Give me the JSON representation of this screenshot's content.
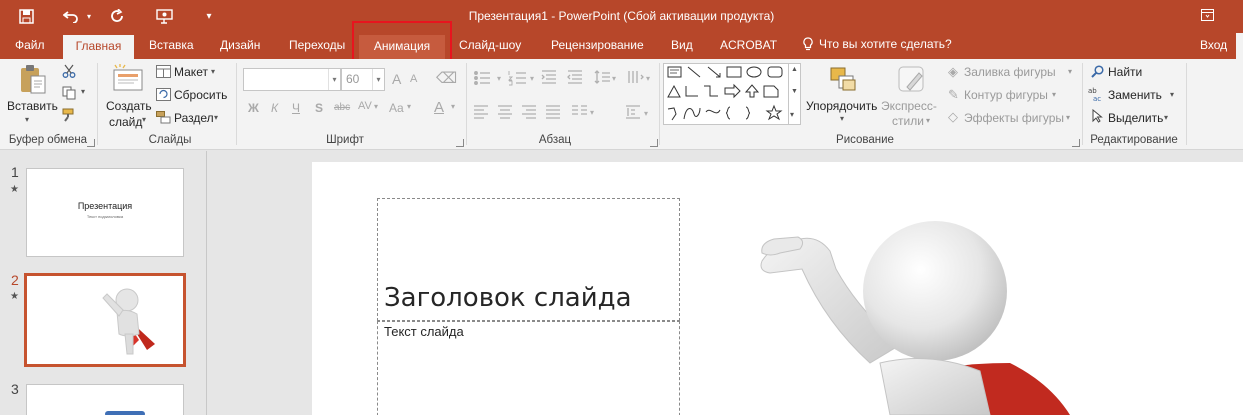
{
  "window": {
    "title": "Презентация1 - PowerPoint (Сбой активации продукта)"
  },
  "tabs": {
    "file": "Файл",
    "home": "Главная",
    "insert": "Вставка",
    "design": "Дизайн",
    "transitions": "Переходы",
    "animations": "Анимация",
    "slideshow": "Слайд-шоу",
    "review": "Рецензирование",
    "view": "Вид",
    "acrobat": "ACROBAT",
    "tell_me": "Что вы хотите сделать?",
    "signin": "Вход"
  },
  "ribbon": {
    "clipboard": {
      "paste": "Вставить",
      "group": "Буфер обмена"
    },
    "slides": {
      "new_slide_1": "Создать",
      "new_slide_2": "слайд",
      "layout": "Макет",
      "reset": "Сбросить",
      "section": "Раздел",
      "group": "Слайды"
    },
    "font": {
      "font_name": "",
      "font_size": "60",
      "bold": "Ж",
      "italic": "К",
      "underline": "Ч",
      "shadow": "S",
      "strike": "abc",
      "spacing": "AV",
      "case": "Aa",
      "color": "A",
      "grow": "A",
      "shrink": "A",
      "group": "Шрифт"
    },
    "paragraph": {
      "group": "Абзац"
    },
    "drawing": {
      "arrange_1": "Упорядочить",
      "quick_styles_1": "Экспресс-",
      "quick_styles_2": "стили",
      "fill": "Заливка фигуры",
      "outline": "Контур фигуры",
      "effects": "Эффекты фигуры",
      "group": "Рисование"
    },
    "editing": {
      "find": "Найти",
      "replace": "Заменить",
      "select": "Выделить",
      "group": "Редактирование"
    }
  },
  "thumbnails": [
    {
      "num": "1",
      "title": "Презентация",
      "subtitle": "Текст подзаголовка"
    },
    {
      "num": "2"
    },
    {
      "num": "3"
    }
  ],
  "slide": {
    "title": "Заголовок слайда",
    "body": "Текст слайда"
  },
  "colors": {
    "accent": "#b7472a",
    "highlight": "#e8141e"
  }
}
